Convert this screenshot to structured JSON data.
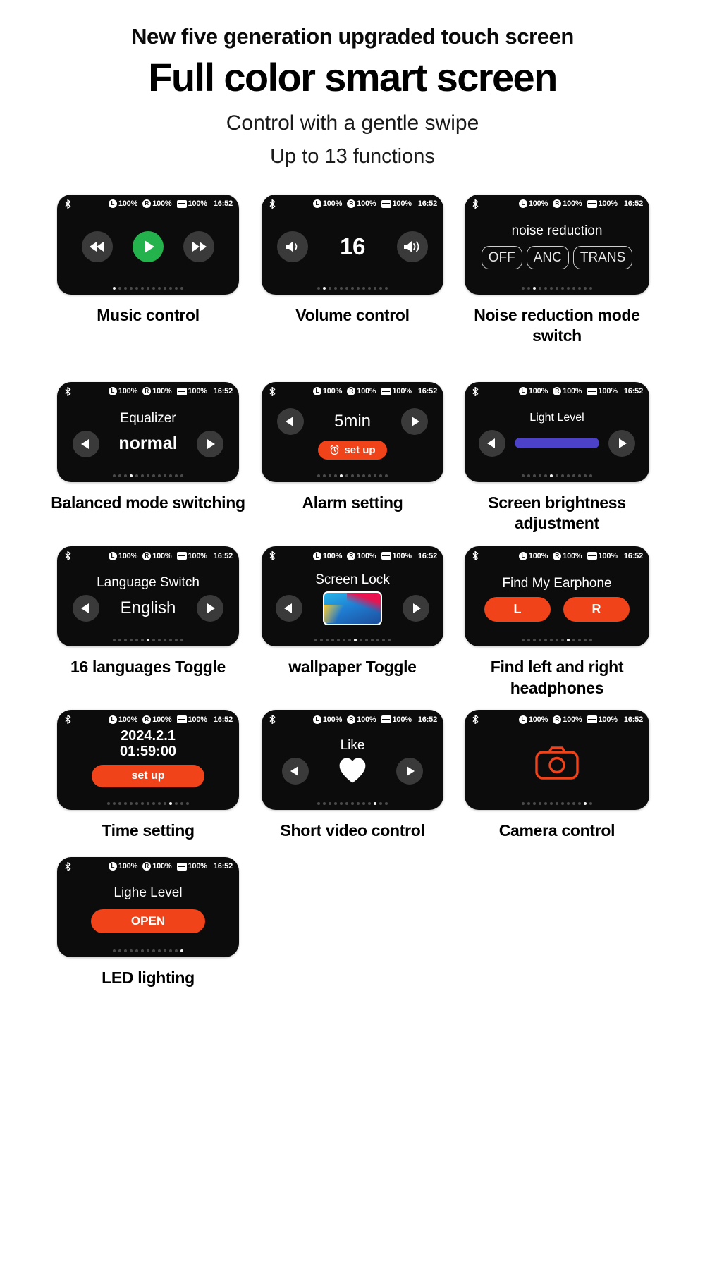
{
  "header": {
    "eyebrow": "New five generation upgraded touch screen",
    "title": "Full color smart screen",
    "subtitle": "Control with a gentle swipe",
    "note": "Up to 13 functions"
  },
  "status_bar": {
    "bluetooth_icon": "bluetooth-icon",
    "left_label": "L",
    "left_value": "100%",
    "right_label": "R",
    "right_value": "100%",
    "battery_value": "100%",
    "time": "16:52"
  },
  "colors": {
    "screen_bg": "#0c0c0c",
    "accent_orange": "#f0431a",
    "play_green": "#24b24c",
    "slider_purple": "#4b42c9",
    "button_gray": "#3a3a3a"
  },
  "cards": [
    {
      "id": "music-control",
      "caption": "Music control",
      "screen_title": "",
      "buttons": [
        "rewind",
        "play",
        "forward"
      ],
      "dots_total": 13,
      "dots_active": 0
    },
    {
      "id": "volume-control",
      "caption": "Volume control",
      "value": "16",
      "buttons": [
        "volume-down",
        "volume-up"
      ],
      "dots_total": 13,
      "dots_active": 1
    },
    {
      "id": "noise-reduction",
      "caption": "Noise reduction mode switch",
      "screen_title": "noise reduction",
      "modes": [
        "OFF",
        "ANC",
        "TRANS"
      ],
      "dots_total": 13,
      "dots_active": 2
    },
    {
      "id": "equalizer",
      "caption": "Balanced mode switching",
      "screen_title": "Equalizer",
      "value": "normal",
      "dots_total": 13,
      "dots_active": 3
    },
    {
      "id": "alarm-setting",
      "caption": "Alarm setting",
      "value": "5min",
      "action_label": "set up",
      "dots_total": 13,
      "dots_active": 4
    },
    {
      "id": "screen-brightness",
      "caption": "Screen brightness adjustment",
      "screen_title": "Light Level",
      "slider_percent": 75,
      "dots_total": 13,
      "dots_active": 5
    },
    {
      "id": "language-switch",
      "caption": "16 languages Toggle",
      "screen_title": "Language Switch",
      "value": "English",
      "dots_total": 13,
      "dots_active": 6
    },
    {
      "id": "wallpaper-toggle",
      "caption": "wallpaper Toggle",
      "screen_title": "Screen Lock",
      "dots_total": 14,
      "dots_active": 7
    },
    {
      "id": "find-my-earphone",
      "caption": "Find left and right headphones",
      "screen_title": "Find My Earphone",
      "left_button": "L",
      "right_button": "R",
      "dots_total": 13,
      "dots_active": 8
    },
    {
      "id": "time-setting",
      "caption": "Time setting",
      "date": "2024.2.1",
      "time": "01:59:00",
      "action_label": "set up",
      "dots_total": 15,
      "dots_active": 11
    },
    {
      "id": "short-video-control",
      "caption": "Short video control",
      "screen_title": "Like",
      "icon": "heart-icon",
      "dots_total": 13,
      "dots_active": 10
    },
    {
      "id": "camera-control",
      "caption": "Camera control",
      "icon": "camera-icon",
      "dots_total": 13,
      "dots_active": 11
    },
    {
      "id": "led-lighting",
      "caption": "LED lighting",
      "screen_title": "Lighe Level",
      "action_label": "OPEN",
      "dots_total": 13,
      "dots_active": 12
    }
  ]
}
